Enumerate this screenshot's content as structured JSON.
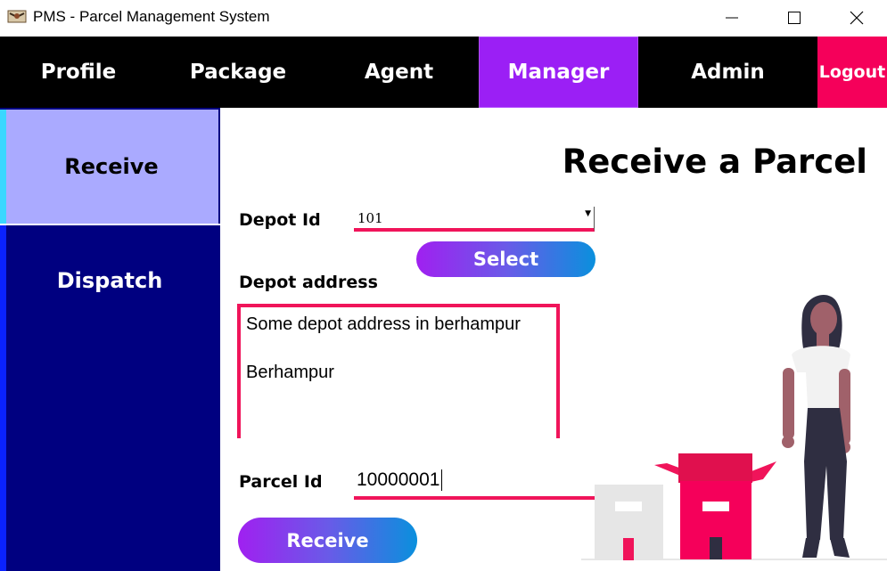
{
  "window": {
    "title": "PMS - Parcel Management System",
    "icon": "parcel-app-icon"
  },
  "window_controls": {
    "minimize_icon": "minimize-icon",
    "maximize_icon": "maximize-icon",
    "close_icon": "close-icon"
  },
  "nav": {
    "items": [
      {
        "label": "Profile"
      },
      {
        "label": "Package"
      },
      {
        "label": "Agent"
      },
      {
        "label": "Manager",
        "active": true
      },
      {
        "label": "Admin"
      },
      {
        "label": "Logout"
      }
    ]
  },
  "sidebar": {
    "items": [
      {
        "label": "Receive",
        "active": true
      },
      {
        "label": "Dispatch"
      }
    ]
  },
  "main": {
    "title": "Receive a Parcel",
    "depot_id_label": "Depot Id",
    "depot_id_value": "101",
    "select_button": "Select",
    "depot_address_label": "Depot address",
    "depot_address_lines": [
      "Some depot address in berhampur",
      "Berhampur"
    ],
    "parcel_id_label": "Parcel Id",
    "parcel_id_value": "10000001",
    "receive_button": "Receive"
  },
  "colors": {
    "accent_pink": "#f0145a",
    "manager_tab": "#9b1ff5",
    "logout": "#f5005a",
    "sidebar_bg": "#000080",
    "sidebar_active": "#aaaaff",
    "button_gradient_start": "#a020f0",
    "button_gradient_end": "#0a90dd"
  }
}
